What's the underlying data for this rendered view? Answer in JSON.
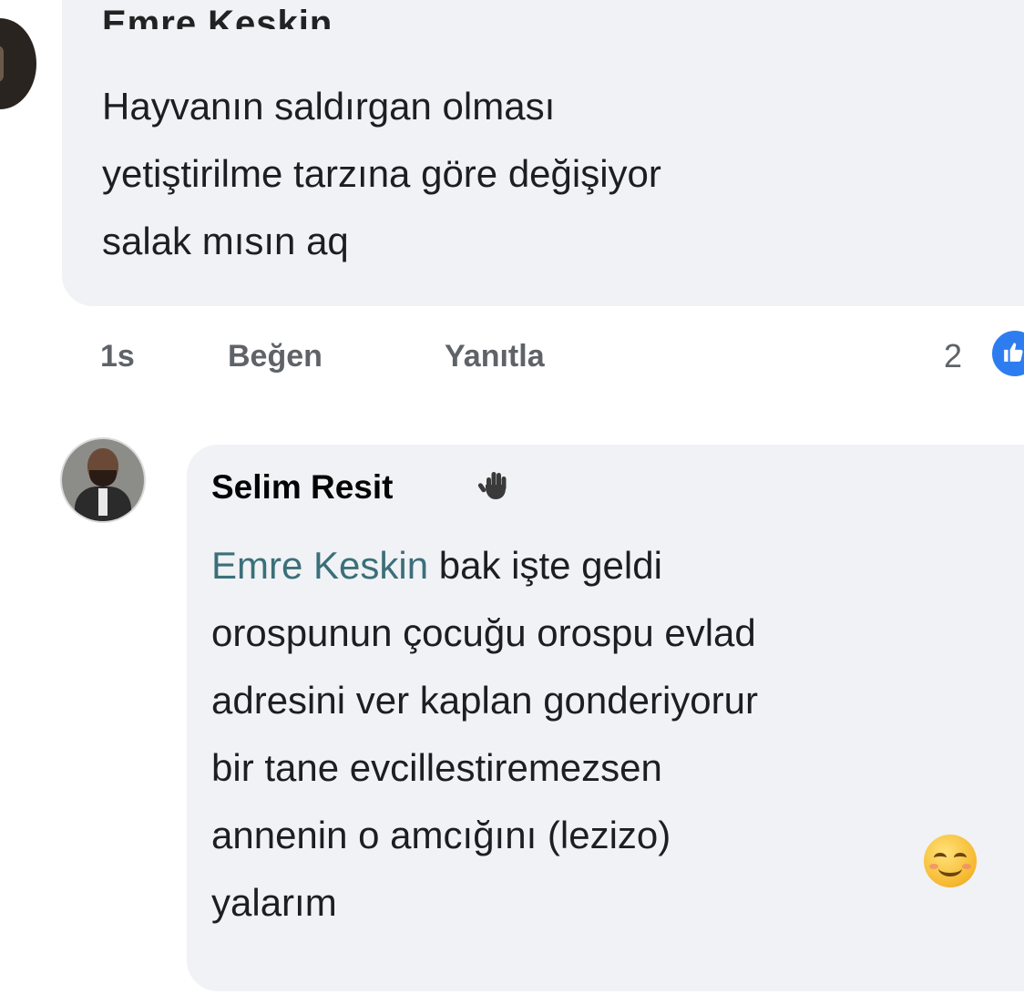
{
  "comment_1": {
    "author": "Emre Keskin",
    "lines": [
      "Hayvanın saldırgan olması",
      "yetiştirilme tarzına göre değişiyor",
      "salak mısın aq"
    ],
    "time": "1s",
    "like_label": "Beğen",
    "reply_label": "Yanıtla",
    "reaction_count": "2",
    "reaction_icon": "like-icon"
  },
  "comment_2": {
    "author": "Selim Resit",
    "author_badge_icon": "waving-hand-icon",
    "mention": "Emre Keskin",
    "line_1_rest": " bak işte geldi",
    "lines": [
      "orospunun çocuğu orospu evlad",
      "adresini ver kaplan gonderiyorur",
      "bir tane evcillestiremezsen",
      "annenin o amcığını (lezizo) "
    ],
    "last_line": "yalarım",
    "emoji_icon": "smiling-face-icon"
  },
  "colors": {
    "bubble": "#f0f2f5",
    "mention": "#3b6f79",
    "like_blue": "#2e7df0",
    "meta_text": "#5f6368"
  }
}
